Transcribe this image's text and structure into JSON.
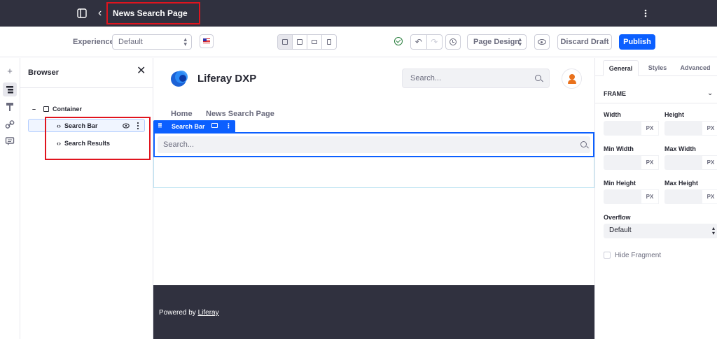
{
  "topbar": {
    "title": "News Search Page"
  },
  "toolbar": {
    "experience_label": "Experience",
    "experience_value": "Default",
    "page_design_label": "Page Design",
    "discard_label": "Discard Draft",
    "publish_label": "Publish"
  },
  "browser": {
    "title": "Browser",
    "tree": {
      "container": "Container",
      "items": [
        "Search Bar",
        "Search Results"
      ]
    }
  },
  "canvas": {
    "brand": "Liferay DXP",
    "search_placeholder": "Search...",
    "nav": [
      "Home",
      "News Search Page"
    ],
    "fragment_label": "Search Bar",
    "fragment_search_placeholder": "Search...",
    "footer_text": "Powered by ",
    "footer_link": "Liferay"
  },
  "panel": {
    "tabs": [
      "General",
      "Styles",
      "Advanced"
    ],
    "section": "FRAME",
    "fields": {
      "width": "Width",
      "height": "Height",
      "min_width": "Min Width",
      "max_width": "Max Width",
      "min_height": "Min Height",
      "max_height": "Max Height",
      "unit": "PX"
    },
    "overflow_label": "Overflow",
    "overflow_value": "Default",
    "hide_fragment": "Hide Fragment"
  },
  "colors": {
    "accent": "#0b5fff",
    "highlight": "#e0141e",
    "dark": "#30313f"
  }
}
